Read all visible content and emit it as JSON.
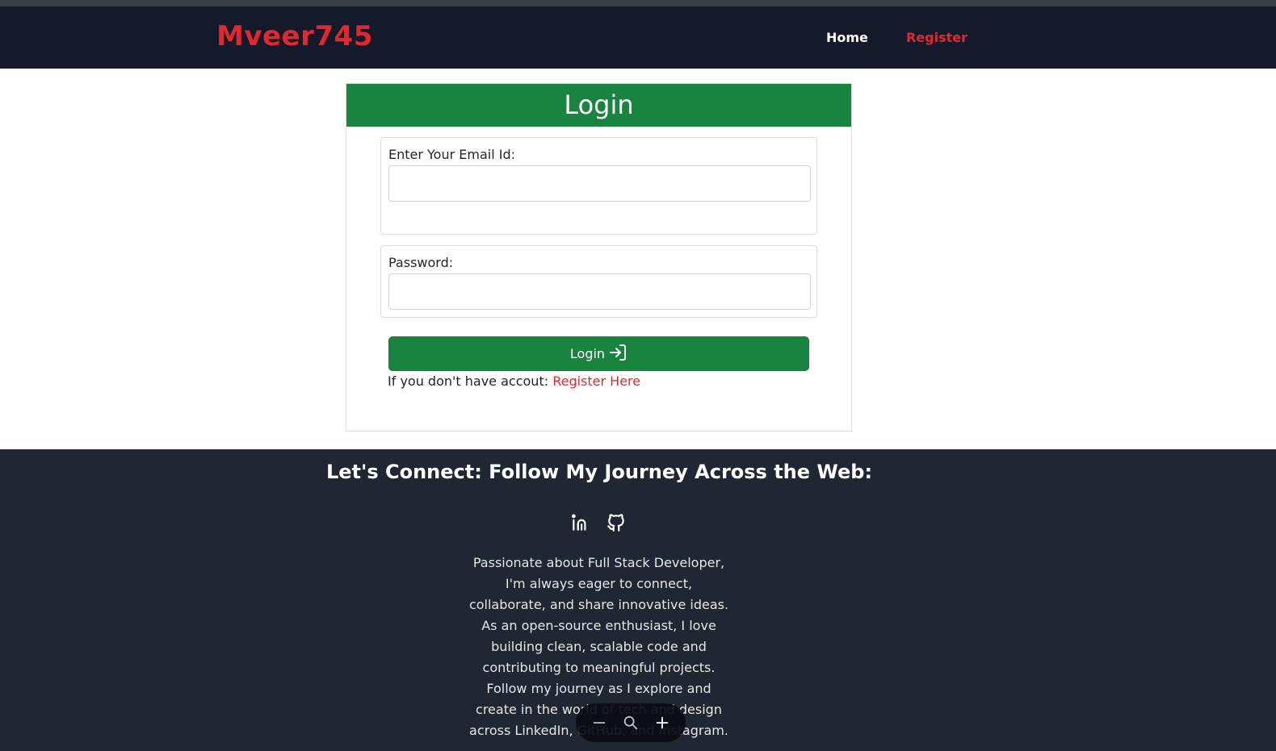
{
  "nav": {
    "brand": "Mveer745",
    "links": [
      {
        "label": "Home"
      },
      {
        "label": "Register"
      }
    ]
  },
  "login": {
    "header": "Login",
    "email_label": "Enter Your Email Id:",
    "email_value": "",
    "password_label": "Password:",
    "password_value": "",
    "button_label": "Login",
    "register_prompt": "If you don't have accout:",
    "register_link": "Register Here"
  },
  "footer": {
    "title": "Let's Connect: Follow My Journey Across the Web:",
    "social_icons": [
      "linkedin-icon",
      "github-icon"
    ],
    "description": "Passionate about Full Stack Developer, I'm always eager to connect, collaborate, and share innovative ideas. As an open-source enthusiast, I love building clean, scalable code and contributing to meaningful projects. Follow my journey as I explore and create in the world of tech and design across LinkedIn, GitHub, and Instagram."
  },
  "zoom_controls": {
    "icons": [
      "zoom-out-icon",
      "magnifier-icon",
      "zoom-in-icon"
    ]
  },
  "colors": {
    "accent_red": "#e0282e",
    "primary_green": "#198440",
    "navbar_bg": "#141a2a",
    "footer_bg": "#1f2634"
  }
}
